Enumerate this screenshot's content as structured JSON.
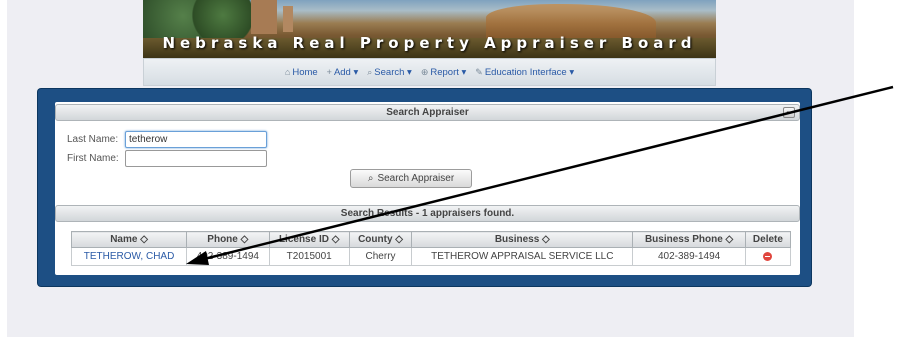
{
  "banner": {
    "title": "Nebraska Real Property Appraiser Board"
  },
  "nav": {
    "items": [
      {
        "icon": "home-icon",
        "label": "Home"
      },
      {
        "icon": "plus-icon",
        "label": "Add ▾"
      },
      {
        "icon": "search-icon",
        "label": "Search ▾"
      },
      {
        "icon": "report-icon",
        "label": "Report ▾"
      },
      {
        "icon": "pencil-icon",
        "label": "Education Interface ▾"
      }
    ]
  },
  "search_panel": {
    "title": "Search Appraiser",
    "collapse_label": "−",
    "last_name_label": "Last Name:",
    "last_name_value": "tetherow",
    "first_name_label": "First Name:",
    "first_name_value": "",
    "search_button": "Search Appraiser"
  },
  "results_panel": {
    "title": "Search Results - 1 appraisers found.",
    "columns": [
      "Name ◇",
      "Phone ◇",
      "License ID ◇",
      "County ◇",
      "Business ◇",
      "Business Phone ◇",
      "Delete"
    ],
    "rows": [
      {
        "name": "TETHEROW, CHAD",
        "phone": "402-389-1494",
        "license_id": "T2015001",
        "county": "Cherry",
        "business": "TETHEROW APPRAISAL SERVICE LLC",
        "business_phone": "402-389-1494"
      }
    ]
  },
  "colors": {
    "frame": "#1d4f84",
    "link": "#2a5aa6",
    "delete": "#e0463e",
    "arrow": "#000000"
  }
}
